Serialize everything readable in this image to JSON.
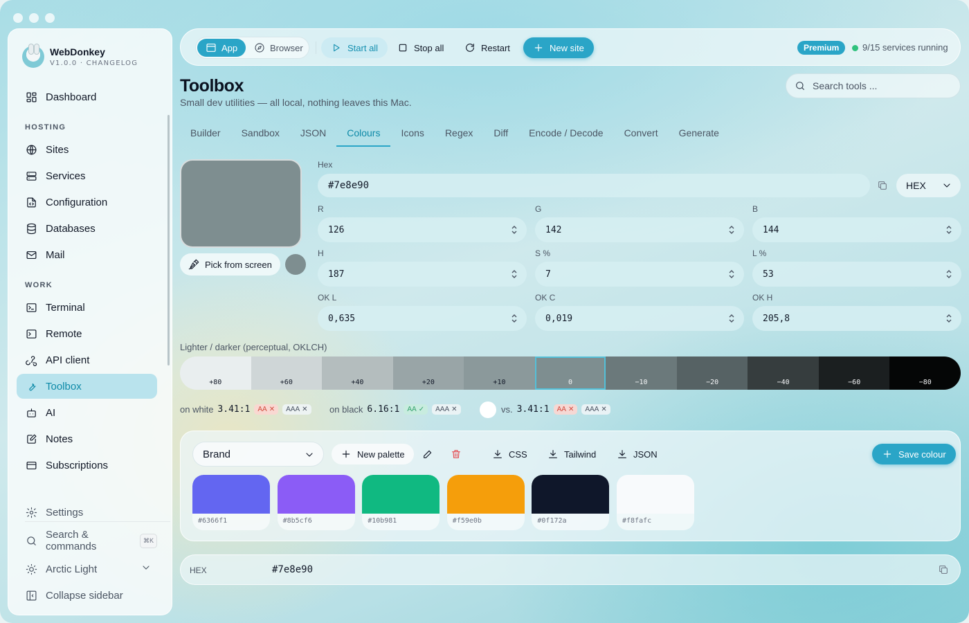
{
  "app": {
    "name": "WebDonkey",
    "version_line": "V1.0.0 · CHANGELOG"
  },
  "sidebar": {
    "dashboard": "Dashboard",
    "hosting_heading": "HOSTING",
    "hosting": [
      "Sites",
      "Services",
      "Configuration",
      "Databases",
      "Mail"
    ],
    "work_heading": "WORK",
    "work": [
      "Terminal",
      "Remote",
      "API client",
      "Toolbox",
      "AI",
      "Notes",
      "Subscriptions"
    ],
    "active": "Toolbox",
    "settings": "Settings",
    "search_commands": "Search & commands",
    "search_shortcut": "⌘K",
    "theme": "Arctic Light",
    "collapse": "Collapse sidebar"
  },
  "topbar": {
    "mode_app": "App",
    "mode_browser": "Browser",
    "start_all": "Start all",
    "stop_all": "Stop all",
    "restart": "Restart",
    "new_site": "New site",
    "premium": "Premium",
    "status": "9/15 services running"
  },
  "page": {
    "title": "Toolbox",
    "subtitle": "Small dev utilities — all local, nothing leaves this Mac.",
    "search_placeholder": "Search tools ..."
  },
  "tabs": [
    "Builder",
    "Sandbox",
    "JSON",
    "Colours",
    "Icons",
    "Regex",
    "Diff",
    "Encode / Decode",
    "Convert",
    "Generate"
  ],
  "active_tab": "Colours",
  "colour": {
    "current_hex": "#7e8e90",
    "pick_label": "Pick from screen",
    "hex_label": "Hex",
    "hex_value": "#7e8e90",
    "format": "HEX",
    "fields": {
      "r": {
        "label": "R",
        "value": "126"
      },
      "g": {
        "label": "G",
        "value": "142"
      },
      "b": {
        "label": "B",
        "value": "144"
      },
      "h": {
        "label": "H",
        "value": "187"
      },
      "s": {
        "label": "S %",
        "value": "7"
      },
      "l": {
        "label": "L %",
        "value": "53"
      },
      "okl": {
        "label": "OK L",
        "value": "0,635"
      },
      "okc": {
        "label": "OK C",
        "value": "0,019"
      },
      "okh": {
        "label": "OK H",
        "value": "205,8"
      }
    }
  },
  "shades": {
    "label": "Lighter / darker (perceptual, OKLCH)",
    "steps": [
      {
        "label": "+80",
        "color": "#e9eeef",
        "text": "#111827"
      },
      {
        "label": "+60",
        "color": "#cfd6d7",
        "text": "#111827"
      },
      {
        "label": "+40",
        "color": "#b4bdbe",
        "text": "#111827"
      },
      {
        "label": "+20",
        "color": "#99a5a7",
        "text": "#111827"
      },
      {
        "label": "+10",
        "color": "#8b999b",
        "text": "#111827"
      },
      {
        "label": "0",
        "color": "#7e8e90",
        "text": "#f3f4f6"
      },
      {
        "label": "−10",
        "color": "#6b797b",
        "text": "#f3f4f6"
      },
      {
        "label": "−20",
        "color": "#566264",
        "text": "#f3f4f6"
      },
      {
        "label": "−40",
        "color": "#363d3e",
        "text": "#f3f4f6"
      },
      {
        "label": "−60",
        "color": "#1b1f20",
        "text": "#f3f4f6"
      },
      {
        "label": "−80",
        "color": "#050606",
        "text": "#f3f4f6"
      }
    ],
    "selected_label": "0"
  },
  "contrast": {
    "on_white_label": "on white",
    "on_white_ratio": "3.41:1",
    "on_black_label": "on black",
    "on_black_ratio": "6.16:1",
    "vs_label": "vs.",
    "vs_ratio": "3.41:1",
    "aa": "AA",
    "aaa": "AAA",
    "fail_mark": "✕",
    "pass_mark": "✓"
  },
  "palette": {
    "selected": "Brand",
    "new_palette": "New palette",
    "export_css": "CSS",
    "export_tailwind": "Tailwind",
    "export_json": "JSON",
    "save": "Save colour",
    "swatches": [
      "#6366f1",
      "#8b5cf6",
      "#10b981",
      "#f59e0b",
      "#0f172a",
      "#f8fafc"
    ]
  },
  "output": {
    "label": "HEX",
    "value": "#7e8e90"
  },
  "colors": {
    "accent": "#2aa5c7",
    "active_text": "#0e8aa8",
    "running_dot": "#2fc27d"
  }
}
